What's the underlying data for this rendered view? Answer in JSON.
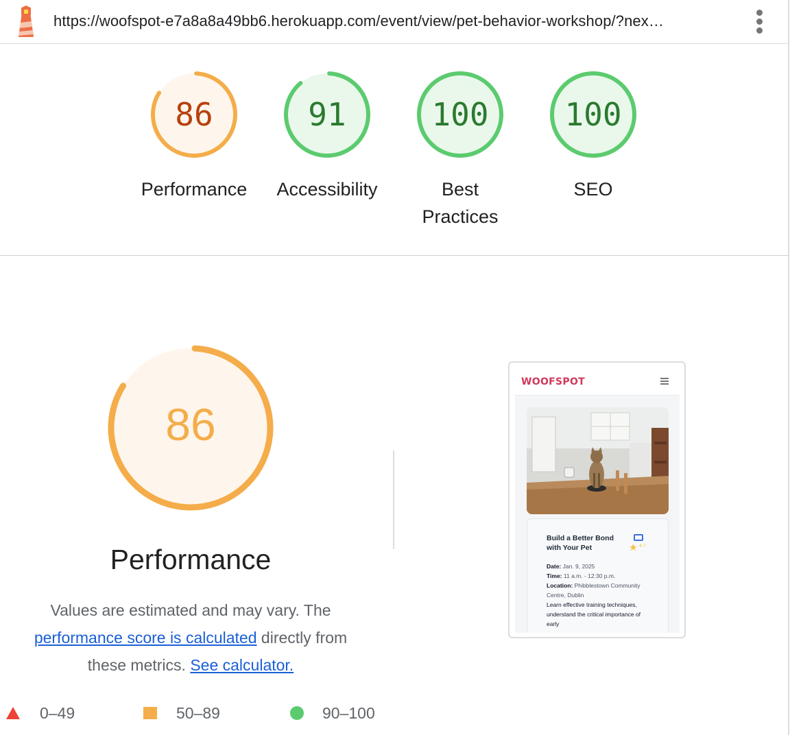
{
  "topbar": {
    "url": "https://woofspot-e7a8a8a49bb6.herokuapp.com/event/view/pet-behavior-workshop/?nex…",
    "logo_icon": "lighthouse-icon",
    "menu_icon": "more-vert-icon"
  },
  "scores": [
    {
      "label": "Performance",
      "value": 86,
      "color": "#f4ad4a",
      "text_color": "#b7410e",
      "fill": "#fef6ec"
    },
    {
      "label": "Accessibility",
      "value": 91,
      "color": "#5ccb6f",
      "text_color": "#2b7a2f",
      "fill": "#eaf8ec"
    },
    {
      "label": "Best Practices",
      "value": 100,
      "color": "#5ccb6f",
      "text_color": "#2b7a2f",
      "fill": "#eaf8ec"
    },
    {
      "label": "SEO",
      "value": 100,
      "color": "#5ccb6f",
      "text_color": "#2b7a2f",
      "fill": "#eaf8ec"
    }
  ],
  "performance": {
    "score": "86",
    "title": "Performance",
    "desc_part1": "Values are estimated and may vary. The",
    "link1": "performance score is calculated",
    "desc_part2": " directly from these metrics. ",
    "link2": "See calculator."
  },
  "legend": [
    {
      "range": "0–49",
      "icon": "triangle-icon",
      "color": "#eb4335"
    },
    {
      "range": "50–89",
      "icon": "square-icon",
      "color": "#f4ad4a"
    },
    {
      "range": "90–100",
      "icon": "circle-icon",
      "color": "#5ccb6f"
    }
  ],
  "screenshot": {
    "brand": "WOOFSPOT",
    "card_title": "Build a Better Bond with Your Pet",
    "rating": "4.7",
    "date_label": "Date:",
    "date_value": " Jan. 9, 2025",
    "time_label": "Time:",
    "time_value": " 11 a.m. - 12:30 p.m.",
    "location_label": "Location:",
    "location_value": " Phibblestown Community Centre, Dublin",
    "description": "Learn effective training techniques, understand the critical importance of early"
  }
}
